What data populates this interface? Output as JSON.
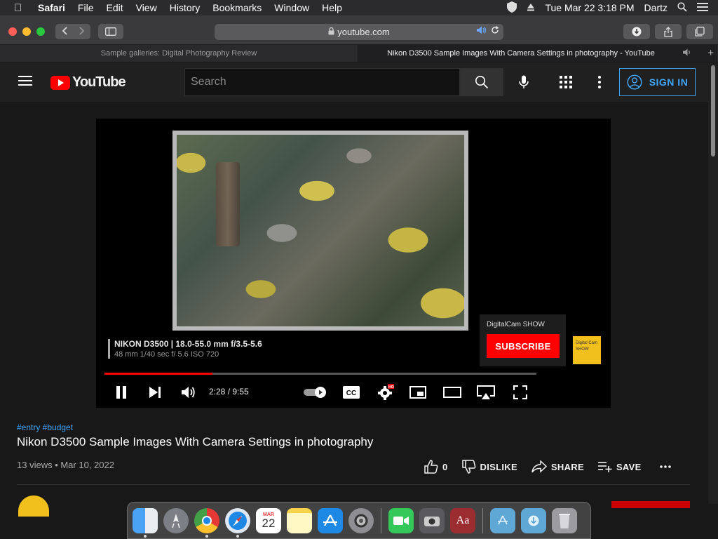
{
  "menubar": {
    "app": "Safari",
    "items": [
      "File",
      "Edit",
      "View",
      "History",
      "Bookmarks",
      "Window",
      "Help"
    ],
    "datetime": "Tue Mar 22  3:18 PM",
    "user": "Dartz"
  },
  "toolbar": {
    "url": "youtube.com"
  },
  "tabs": [
    {
      "label": "Sample galleries: Digital Photography Review",
      "active": false
    },
    {
      "label": "Nikon D3500 Sample Images With Camera Settings in photography - YouTube",
      "active": true
    }
  ],
  "youtube": {
    "logo_text": "YouTube",
    "search_placeholder": "Search",
    "sign_in": "SIGN IN"
  },
  "player": {
    "caption_line1": "NIKON D3500 | 18.0-55.0 mm f/3.5-5.6",
    "caption_line2": "48 mm 1/40 sec f/ 5.6 ISO 720",
    "time": "2:28 / 9:55",
    "progress_fraction": 0.25,
    "hd_badge": "HD",
    "channel_card_name": "DigitalCam SHOW",
    "subscribe_label": "SUBSCRIBE",
    "channel_logo_text": "Digital Cam SHOW"
  },
  "video": {
    "tags": "#entry #budget",
    "title": "Nikon D3500 Sample Images With Camera Settings in photography",
    "views_date": "13 views • Mar 10, 2022",
    "like_count": "0",
    "dislike_label": "DISLIKE",
    "share_label": "SHARE",
    "save_label": "SAVE"
  },
  "dock": {
    "calendar_month": "MAR",
    "calendar_day": "22"
  },
  "colors": {
    "youtube_red": "#ff0000",
    "link_blue": "#3ea6ff",
    "background": "#181818"
  }
}
